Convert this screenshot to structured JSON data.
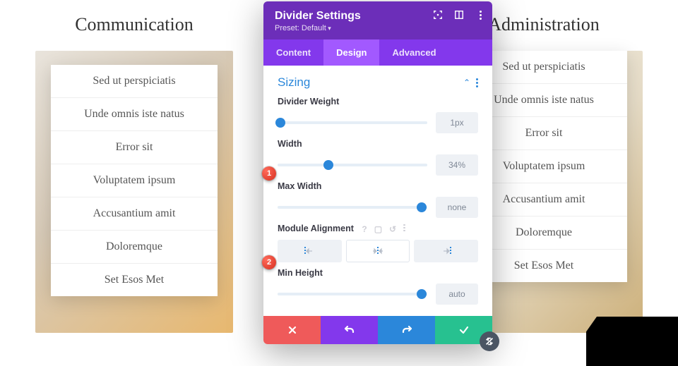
{
  "columns": {
    "left": {
      "title": "Communication",
      "items": [
        "Sed ut perspiciatis",
        "Unde omnis iste natus",
        "Error sit",
        "Voluptatem ipsum",
        "Accusantium amit",
        "Doloremque",
        "Set Esos Met"
      ]
    },
    "right": {
      "title": "Administration",
      "items": [
        "Sed ut perspiciatis",
        "Unde omnis iste natus",
        "Error sit",
        "Voluptatem ipsum",
        "Accusantium amit",
        "Doloremque",
        "Set Esos Met"
      ]
    }
  },
  "modal": {
    "title": "Divider Settings",
    "preset": "Preset: Default",
    "tabs": {
      "content": "Content",
      "design": "Design",
      "advanced": "Advanced",
      "active": "design"
    },
    "section": "Sizing",
    "fields": {
      "divider_weight": {
        "label": "Divider Weight",
        "value": "1px",
        "percent": 2
      },
      "width": {
        "label": "Width",
        "value": "34%",
        "percent": 34
      },
      "max_width": {
        "label": "Max Width",
        "value": "none",
        "percent": 96
      },
      "module_align": {
        "label": "Module Alignment",
        "selected": "center"
      },
      "min_height": {
        "label": "Min Height",
        "value": "auto",
        "percent": 96
      }
    }
  },
  "badges": {
    "one": "1",
    "two": "2"
  }
}
